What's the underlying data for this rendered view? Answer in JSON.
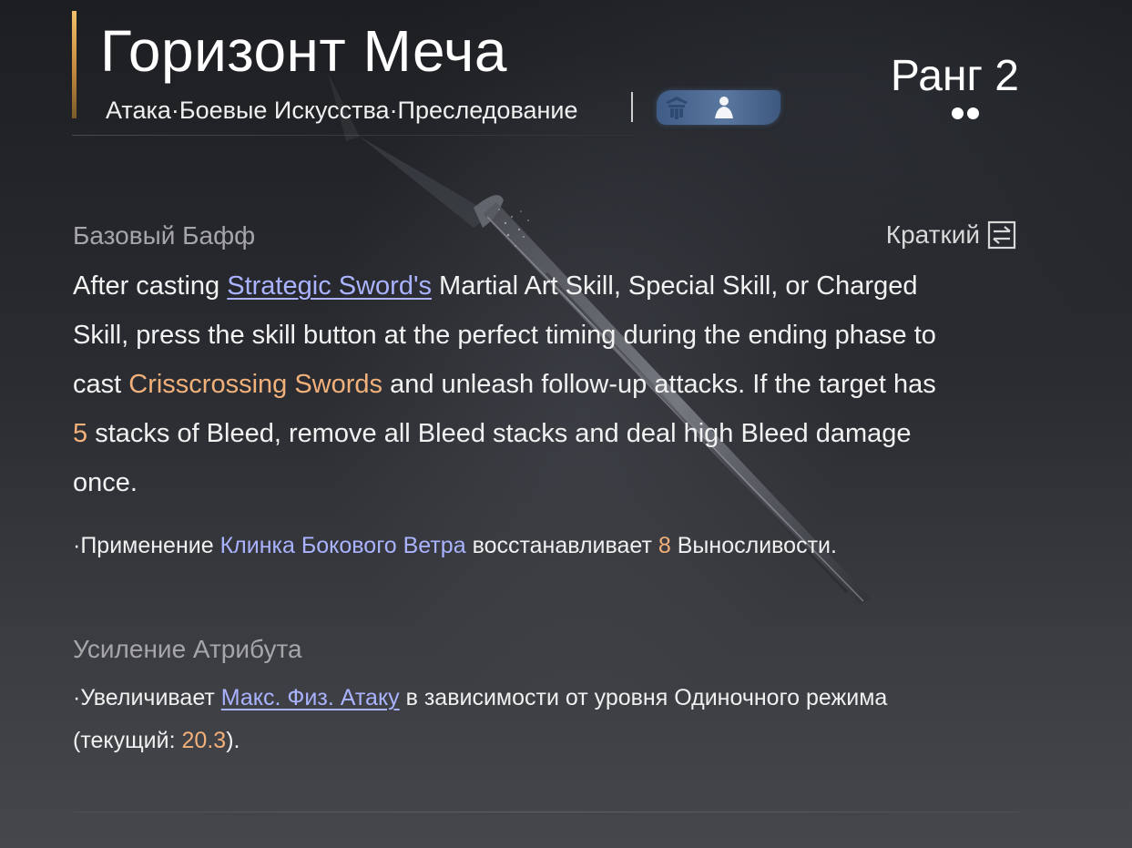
{
  "header": {
    "title": "Горизонт Меча",
    "subtitle": "Атака·Боевые Искусства·Преследование",
    "tag_icons": [
      "guard-stance-icon",
      "figure-icon"
    ],
    "rank": "Ранг 2",
    "rank_level": 2,
    "accent_color": "#e6b060"
  },
  "base_buff": {
    "label": "Базовый Бафф",
    "toggle_label": "Краткий",
    "toggle_icon": "swap-arrows-icon",
    "description": {
      "p1": "After casting ",
      "link_skill": "Strategic Sword's",
      "p2": " Martial Art Skill, Special Skill, or Charged Skill, press the skill button at the perfect timing during the ending phase to cast ",
      "highlight_skill": "Crisscrossing Swords",
      "p3": " and unleash follow-up attacks. If the target has ",
      "stack_count": "5",
      "p4": " stacks of Bleed, remove all Bleed stacks and deal high Bleed damage once."
    },
    "bullet": {
      "prefix": "·Применение ",
      "skill": "Клинка Бокового Ветра",
      "middle": " восстанавливает ",
      "amount": "8",
      "suffix": " Выносливости."
    }
  },
  "attribute_boost": {
    "label": "Усиление Атрибута",
    "bullet": {
      "prefix": "·Увеличивает ",
      "stat": "Макс. Физ. Атаку",
      "middle": " в зависимости от уровня Одиночного режима (текущий: ",
      "value": "20.3",
      "suffix": ")."
    }
  },
  "colors": {
    "link_blue": "#aab3ff",
    "highlight_orange": "#f2b07a",
    "label_gray": "#a6a6a9"
  }
}
